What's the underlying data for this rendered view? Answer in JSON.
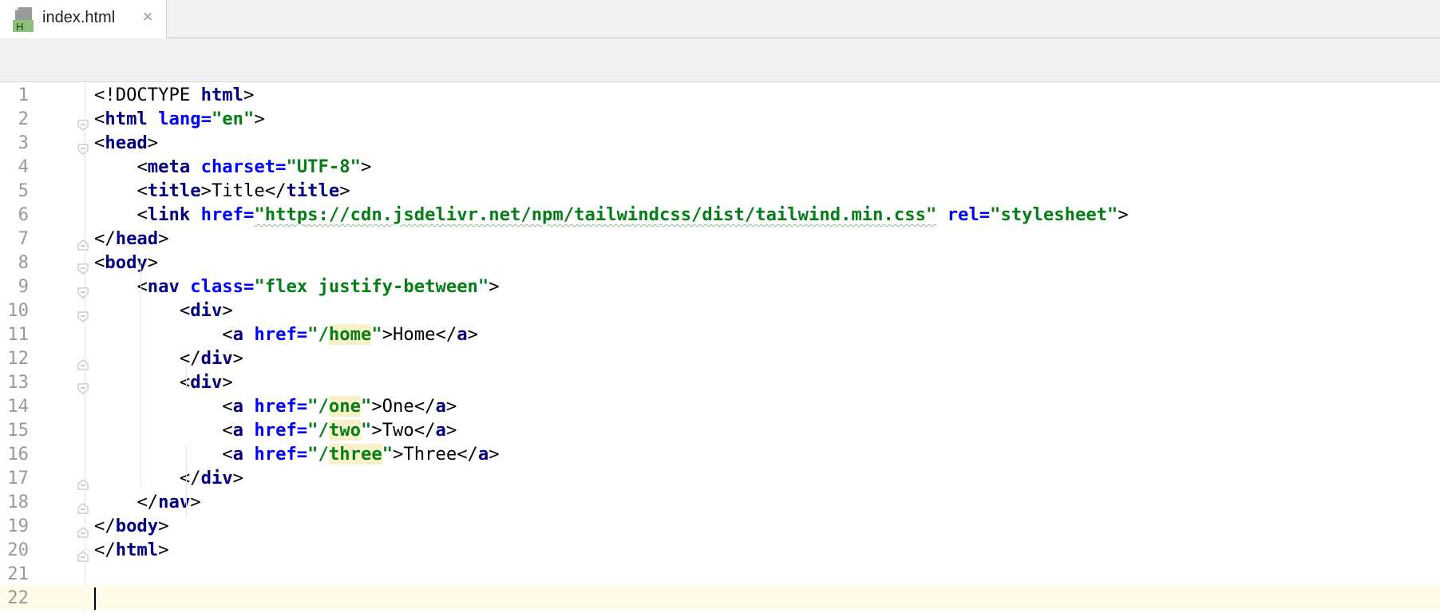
{
  "tab": {
    "file_name": "index.html",
    "icon_letter": "H",
    "close_glyph": "×"
  },
  "editor": {
    "line_numbers": [
      "1",
      "2",
      "3",
      "4",
      "5",
      "6",
      "7",
      "8",
      "9",
      "10",
      "11",
      "12",
      "13",
      "14",
      "15",
      "16",
      "17",
      "18",
      "19",
      "20",
      "21",
      "22"
    ],
    "current_line": 22,
    "lines": [
      [
        {
          "t": "<!DOCTYPE "
        },
        {
          "t": "html",
          "c": "tag"
        },
        {
          "t": ">"
        }
      ],
      [
        {
          "t": "<"
        },
        {
          "t": "html",
          "c": "tag"
        },
        {
          "t": " "
        },
        {
          "t": "lang=",
          "c": "attr"
        },
        {
          "t": "\"en\"",
          "c": "val"
        },
        {
          "t": ">"
        }
      ],
      [
        {
          "t": "<"
        },
        {
          "t": "head",
          "c": "tag"
        },
        {
          "t": ">"
        }
      ],
      [
        {
          "t": "    "
        },
        {
          "t": "<"
        },
        {
          "t": "meta",
          "c": "tag"
        },
        {
          "t": " "
        },
        {
          "t": "charset=",
          "c": "attr"
        },
        {
          "t": "\"UTF-8\"",
          "c": "val"
        },
        {
          "t": ">"
        }
      ],
      [
        {
          "t": "    "
        },
        {
          "t": "<"
        },
        {
          "t": "title",
          "c": "tag"
        },
        {
          "t": ">Title</"
        },
        {
          "t": "title",
          "c": "tag"
        },
        {
          "t": ">"
        }
      ],
      [
        {
          "t": "    "
        },
        {
          "t": "<"
        },
        {
          "t": "link",
          "c": "tag"
        },
        {
          "t": " "
        },
        {
          "t": "href=",
          "c": "attr"
        },
        {
          "t": "\"https://cdn.jsdelivr.net/npm/tailwindcss/dist/tailwind.min.css\"",
          "c": "val"
        },
        {
          "t": " "
        },
        {
          "t": "rel=",
          "c": "attr"
        },
        {
          "t": "\"stylesheet\"",
          "c": "val"
        },
        {
          "t": ">"
        }
      ],
      [
        {
          "t": "</"
        },
        {
          "t": "head",
          "c": "tag"
        },
        {
          "t": ">"
        }
      ],
      [
        {
          "t": "<"
        },
        {
          "t": "body",
          "c": "tag"
        },
        {
          "t": ">"
        }
      ],
      [
        {
          "t": "    "
        },
        {
          "t": "<"
        },
        {
          "t": "nav",
          "c": "tag"
        },
        {
          "t": " "
        },
        {
          "t": "class=",
          "c": "attr"
        },
        {
          "t": "\"flex justify-between\"",
          "c": "val"
        },
        {
          "t": ">"
        }
      ],
      [
        {
          "t": "        "
        },
        {
          "t": "<"
        },
        {
          "t": "div",
          "c": "tag"
        },
        {
          "t": ">"
        }
      ],
      [
        {
          "t": "            "
        },
        {
          "t": "<"
        },
        {
          "t": "a",
          "c": "tag"
        },
        {
          "t": " "
        },
        {
          "t": "href=",
          "c": "attr"
        },
        {
          "t": "\"/",
          "c": "val"
        },
        {
          "t": "home",
          "c": "val hl"
        },
        {
          "t": "\"",
          "c": "val"
        },
        {
          "t": ">Home</"
        },
        {
          "t": "a",
          "c": "tag"
        },
        {
          "t": ">"
        }
      ],
      [
        {
          "t": "        "
        },
        {
          "t": "</"
        },
        {
          "t": "div",
          "c": "tag"
        },
        {
          "t": ">"
        }
      ],
      [
        {
          "t": "        "
        },
        {
          "t": "<"
        },
        {
          "t": "div",
          "c": "tag"
        },
        {
          "t": ">"
        }
      ],
      [
        {
          "t": "            "
        },
        {
          "t": "<"
        },
        {
          "t": "a",
          "c": "tag"
        },
        {
          "t": " "
        },
        {
          "t": "href=",
          "c": "attr"
        },
        {
          "t": "\"/",
          "c": "val"
        },
        {
          "t": "one",
          "c": "val hl"
        },
        {
          "t": "\"",
          "c": "val"
        },
        {
          "t": ">One</"
        },
        {
          "t": "a",
          "c": "tag"
        },
        {
          "t": ">"
        }
      ],
      [
        {
          "t": "            "
        },
        {
          "t": "<"
        },
        {
          "t": "a",
          "c": "tag"
        },
        {
          "t": " "
        },
        {
          "t": "href=",
          "c": "attr"
        },
        {
          "t": "\"/",
          "c": "val"
        },
        {
          "t": "two",
          "c": "val hl"
        },
        {
          "t": "\"",
          "c": "val"
        },
        {
          "t": ">Two</"
        },
        {
          "t": "a",
          "c": "tag"
        },
        {
          "t": ">"
        }
      ],
      [
        {
          "t": "            "
        },
        {
          "t": "<"
        },
        {
          "t": "a",
          "c": "tag"
        },
        {
          "t": " "
        },
        {
          "t": "href=",
          "c": "attr"
        },
        {
          "t": "\"/",
          "c": "val"
        },
        {
          "t": "three",
          "c": "val hl"
        },
        {
          "t": "\"",
          "c": "val"
        },
        {
          "t": ">Three</"
        },
        {
          "t": "a",
          "c": "tag"
        },
        {
          "t": ">"
        }
      ],
      [
        {
          "t": "        "
        },
        {
          "t": "</"
        },
        {
          "t": "div",
          "c": "tag"
        },
        {
          "t": ">"
        }
      ],
      [
        {
          "t": "    "
        },
        {
          "t": "</"
        },
        {
          "t": "nav",
          "c": "tag"
        },
        {
          "t": ">"
        }
      ],
      [
        {
          "t": "</"
        },
        {
          "t": "body",
          "c": "tag"
        },
        {
          "t": ">"
        }
      ],
      [
        {
          "t": "</"
        },
        {
          "t": "html",
          "c": "tag"
        },
        {
          "t": ">"
        }
      ],
      [],
      []
    ],
    "fold_markers": {
      "2": "open",
      "3": "open",
      "7": "close",
      "8": "open",
      "9": "open",
      "10": "open",
      "12": "close",
      "13": "open",
      "17": "close",
      "18": "close",
      "19": "close",
      "20": "close"
    }
  }
}
